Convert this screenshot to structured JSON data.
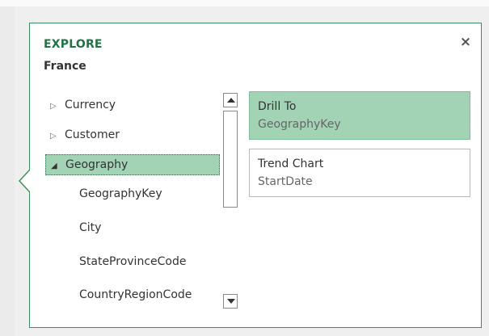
{
  "explore": {
    "title": "EXPLORE",
    "subtitle": "France",
    "close_icon": "×"
  },
  "tree": {
    "items": [
      {
        "label": "Currency",
        "expanded": false,
        "icon": "triangle-right-icon"
      },
      {
        "label": "Customer",
        "expanded": false,
        "icon": "triangle-right-icon"
      },
      {
        "label": "Geography",
        "expanded": true,
        "selected": true,
        "icon": "triangle-down-icon"
      }
    ],
    "children": [
      "GeographyKey",
      "City",
      "StateProvinceCode",
      "CountryRegionCode"
    ]
  },
  "actions": {
    "drill": {
      "title": "Drill To",
      "subtitle": "GeographyKey"
    },
    "trend": {
      "title": "Trend Chart",
      "subtitle": "StartDate"
    }
  },
  "colors": {
    "accent": "#217346",
    "selection": "#a3d3b5",
    "border": "#3a8d5c"
  }
}
